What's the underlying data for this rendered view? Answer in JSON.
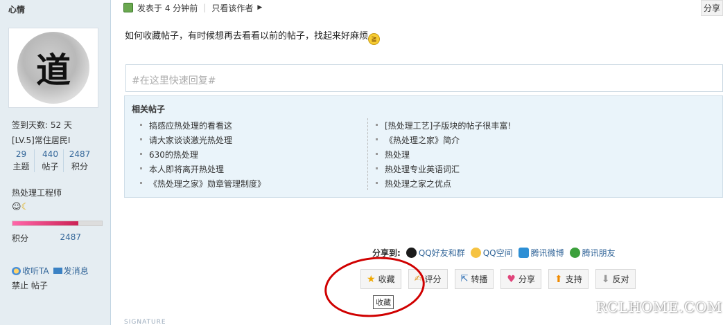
{
  "profile": {
    "username": "心情",
    "avatar_glyph": "道",
    "signin_days": "签到天数: 52 天",
    "level": "[LV.5]常住居民I",
    "stats": [
      {
        "value": "29",
        "label": "主题"
      },
      {
        "value": "440",
        "label": "帖子"
      },
      {
        "value": "2487",
        "label": "积分"
      }
    ],
    "title": "热处理工程师",
    "progress_fraction": 0.74,
    "credit_label": "积分",
    "credit_value": "2487",
    "follow_label": "收听TA",
    "message_label": "发消息",
    "status": "禁止 帖子"
  },
  "post": {
    "posted_prefix": "发表于",
    "posted_time": "4 分钟前",
    "only_author": "只看该作者",
    "share_corner": "分享",
    "content": "如何收藏帖子，有时候想再去看看以前的帖子，找起来好麻烦"
  },
  "quick_reply": {
    "placeholder": "#在这里快速回复#"
  },
  "related": {
    "title": "相关帖子",
    "left": [
      "搞感应热处理的看看这",
      "请大家谈谈激光热处理",
      "630的热处理",
      "本人即将离开热处理",
      "《热处理之家》勋章管理制度》"
    ],
    "right": [
      "[热处理工艺]子版块的帖子很丰富!",
      "《热处理之家》简介",
      "热处理",
      "热处理专业英语词汇",
      "热处理之家之优点"
    ]
  },
  "share": {
    "label": "分享到:",
    "items": [
      "QQ好友和群",
      "QQ空间",
      "腾讯微博",
      "腾讯朋友"
    ]
  },
  "actions": {
    "favorite": "收藏",
    "rate": "评分",
    "repost": "转播",
    "share": "分享",
    "support": "支持",
    "oppose": "反对",
    "tooltip": "收藏"
  },
  "signature_label": "SIGNATURE",
  "watermark": "RCLHOME.COM",
  "colors": {
    "link": "#336699",
    "sidebar_bg": "#e5edf2",
    "related_bg": "#eaf4fa",
    "annotation": "#d00000"
  }
}
